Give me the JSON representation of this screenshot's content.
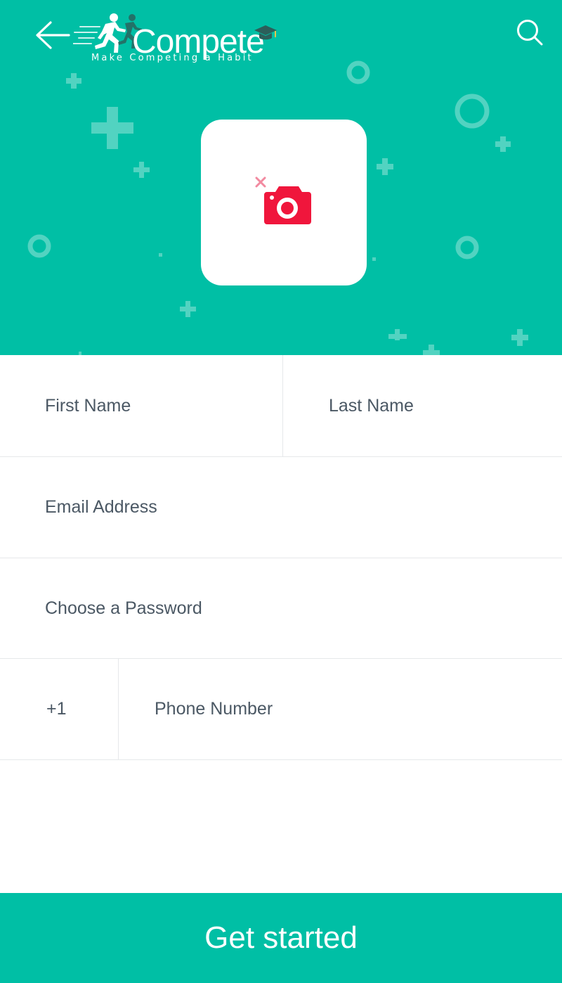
{
  "header": {
    "back_icon": "arrow-left-icon",
    "search_icon": "search-icon",
    "logo": {
      "title": "Compete",
      "tagline": "Make Competing a Habit"
    },
    "background_color": "#00bfa5"
  },
  "avatar_picker": {
    "icon": "camera-icon",
    "icon_color": "#f0163c",
    "badge_icon": "close-icon",
    "badge_color": "#f28aa0"
  },
  "form": {
    "first_name": {
      "placeholder": "First Name"
    },
    "last_name": {
      "placeholder": "Last Name"
    },
    "email": {
      "placeholder": "Email Address"
    },
    "password": {
      "placeholder": "Choose a Password"
    },
    "country_code": "+1",
    "phone": {
      "placeholder": "Phone Number"
    }
  },
  "cta": {
    "label": "Get started"
  },
  "colors": {
    "accent": "#00bfa5",
    "text": "#4b5864",
    "divider": "#e6e8ea"
  }
}
